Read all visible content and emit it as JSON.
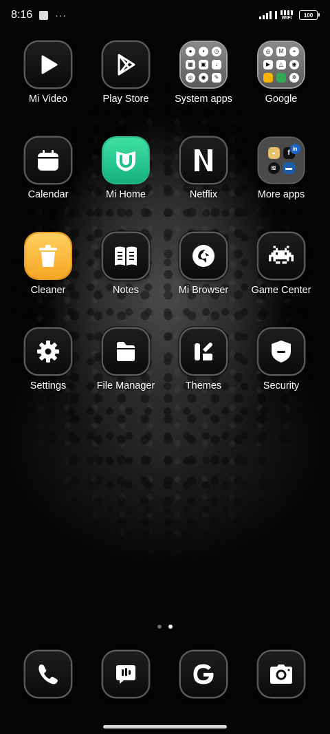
{
  "status_bar": {
    "time": "8:16",
    "more_indicator": "···",
    "wifi_label": "WIFI",
    "battery_level": "100"
  },
  "apps": {
    "mi_video": {
      "label": "Mi Video",
      "icon": "play-icon"
    },
    "play_store": {
      "label": "Play Store",
      "icon": "play-store-icon"
    },
    "system_apps": {
      "label": "System apps",
      "icon": "folder-icon"
    },
    "google": {
      "label": "Google",
      "icon": "folder-icon"
    },
    "calendar": {
      "label": "Calendar",
      "icon": "calendar-icon"
    },
    "mi_home": {
      "label": "Mi Home",
      "icon": "mi-home-icon",
      "color": "#1fc08a"
    },
    "netflix": {
      "label": "Netflix",
      "icon": "netflix-icon"
    },
    "more_apps": {
      "label": "More apps",
      "icon": "folder-icon"
    },
    "cleaner": {
      "label": "Cleaner",
      "icon": "trash-icon",
      "color": "#f8b43a"
    },
    "notes": {
      "label": "Notes",
      "icon": "book-icon"
    },
    "mi_browser": {
      "label": "Mi Browser",
      "icon": "browser-icon"
    },
    "game_center": {
      "label": "Game Center",
      "icon": "space-invader-icon"
    },
    "settings": {
      "label": "Settings",
      "icon": "gear-icon"
    },
    "file_manager": {
      "label": "File Manager",
      "icon": "file-icon"
    },
    "themes": {
      "label": "Themes",
      "icon": "themes-icon"
    },
    "security": {
      "label": "Security",
      "icon": "shield-icon"
    }
  },
  "more_apps_mini": {
    "facebook": "f",
    "linkedin": "in"
  },
  "dock": [
    "phone-icon",
    "messages-icon",
    "google-g-icon",
    "camera-icon"
  ],
  "page_indicator": {
    "pages": 2,
    "current": 2
  }
}
